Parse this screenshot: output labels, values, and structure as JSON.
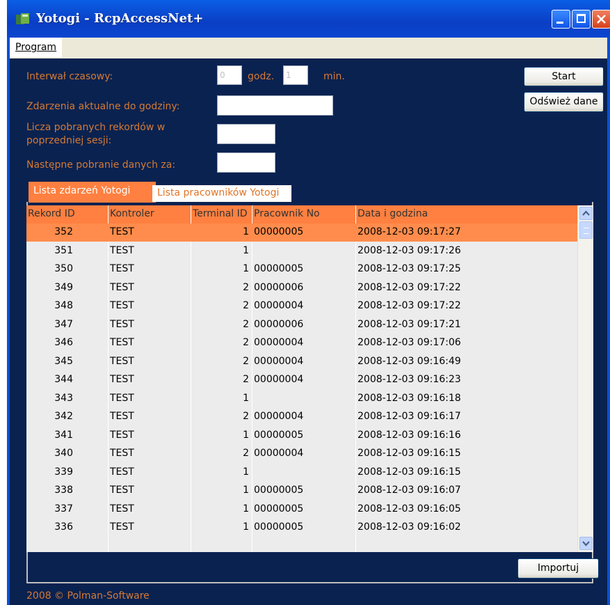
{
  "window": {
    "title": "Yotogi - RcpAccessNet+"
  },
  "menu": {
    "program": "Program"
  },
  "settings": {
    "interval_label": "Interwał czasowy:",
    "hours_value": "0",
    "hours_unit": "godz.",
    "minutes_value": "1",
    "minutes_unit": "min.",
    "events_until_label": "Zdarzenia aktualne do godziny:",
    "events_until_value": "",
    "records_count_label": "Licza pobranych rekordów w poprzedniej sesji:",
    "records_count_value": "",
    "next_fetch_label": "Następne pobranie danych za:",
    "next_fetch_value": ""
  },
  "buttons": {
    "start": "Start",
    "refresh": "Odśwież dane",
    "import": "Importuj"
  },
  "tabs": {
    "events": "Lista zdarzeń Yotogi",
    "employees": "Lista pracowników Yotogi"
  },
  "grid": {
    "headers": {
      "record_id": "Rekord ID",
      "controller": "Kontroler",
      "terminal_id": "Terminal ID",
      "employee_no": "Pracownik No",
      "datetime": "Data i godzina"
    },
    "selected_row": 0,
    "rows": [
      {
        "record_id": "352",
        "controller": "TEST",
        "terminal_id": "1",
        "employee_no": "00000005",
        "datetime": "2008-12-03 09:17:27"
      },
      {
        "record_id": "351",
        "controller": "TEST",
        "terminal_id": "1",
        "employee_no": "",
        "datetime": "2008-12-03 09:17:26"
      },
      {
        "record_id": "350",
        "controller": "TEST",
        "terminal_id": "1",
        "employee_no": "00000005",
        "datetime": "2008-12-03 09:17:25"
      },
      {
        "record_id": "349",
        "controller": "TEST",
        "terminal_id": "2",
        "employee_no": "00000006",
        "datetime": "2008-12-03 09:17:22"
      },
      {
        "record_id": "348",
        "controller": "TEST",
        "terminal_id": "2",
        "employee_no": "00000004",
        "datetime": "2008-12-03 09:17:22"
      },
      {
        "record_id": "347",
        "controller": "TEST",
        "terminal_id": "2",
        "employee_no": "00000006",
        "datetime": "2008-12-03 09:17:21"
      },
      {
        "record_id": "346",
        "controller": "TEST",
        "terminal_id": "2",
        "employee_no": "00000004",
        "datetime": "2008-12-03 09:17:06"
      },
      {
        "record_id": "345",
        "controller": "TEST",
        "terminal_id": "2",
        "employee_no": "00000004",
        "datetime": "2008-12-03 09:16:49"
      },
      {
        "record_id": "344",
        "controller": "TEST",
        "terminal_id": "2",
        "employee_no": "00000004",
        "datetime": "2008-12-03 09:16:23"
      },
      {
        "record_id": "343",
        "controller": "TEST",
        "terminal_id": "1",
        "employee_no": "",
        "datetime": "2008-12-03 09:16:18"
      },
      {
        "record_id": "342",
        "controller": "TEST",
        "terminal_id": "2",
        "employee_no": "00000004",
        "datetime": "2008-12-03 09:16:17"
      },
      {
        "record_id": "341",
        "controller": "TEST",
        "terminal_id": "1",
        "employee_no": "00000005",
        "datetime": "2008-12-03 09:16:16"
      },
      {
        "record_id": "340",
        "controller": "TEST",
        "terminal_id": "2",
        "employee_no": "00000004",
        "datetime": "2008-12-03 09:16:15"
      },
      {
        "record_id": "339",
        "controller": "TEST",
        "terminal_id": "1",
        "employee_no": "",
        "datetime": "2008-12-03 09:16:15"
      },
      {
        "record_id": "338",
        "controller": "TEST",
        "terminal_id": "1",
        "employee_no": "00000005",
        "datetime": "2008-12-03 09:16:07"
      },
      {
        "record_id": "337",
        "controller": "TEST",
        "terminal_id": "1",
        "employee_no": "00000005",
        "datetime": "2008-12-03 09:16:05"
      },
      {
        "record_id": "336",
        "controller": "TEST",
        "terminal_id": "1",
        "employee_no": "00000005",
        "datetime": "2008-12-03 09:16:02"
      }
    ]
  },
  "footer": {
    "copyright": "2008 © Polman-Software"
  },
  "colors": {
    "background": "#0a2250",
    "accent": "#ff8040",
    "label": "#d47a34",
    "titlebar": "#0a46d0"
  }
}
